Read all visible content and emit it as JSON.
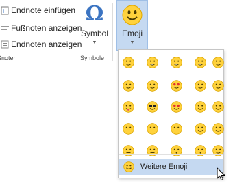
{
  "ribbon": {
    "footnotes": {
      "items": [
        {
          "label": "Endnote einfügen",
          "icon": "insert-endnote-icon"
        },
        {
          "label": "Fußnoten anzeigen",
          "icon": "show-footnotes-icon"
        },
        {
          "label": "Endnoten anzeigen",
          "icon": "show-endnotes-icon"
        }
      ],
      "group_label": "Fußnoten"
    },
    "symbols": {
      "symbol_label": "Symbol",
      "symbol_glyph": "Ω",
      "group_label": "Symbole",
      "emoji_label": "Emoji"
    }
  },
  "emoji_menu": {
    "emojis": [
      [
        "confounded-face",
        "grinning-face",
        "crying-laughing-face",
        "rofl-face",
        "slightly-smiling-face"
      ],
      [
        "smiling-face",
        "sweat-smile-face",
        "heart-eyes-face",
        "upside-down-face",
        "smiling-face-alt"
      ],
      [
        "tongue-out-face",
        "sunglasses-face",
        "heart-eyes-face-alt",
        "kissing-face",
        "squinting-face"
      ],
      [
        "neutral-face",
        "expressionless-face",
        "neutral-face-alt",
        "hugging-face",
        "thinking-face"
      ],
      [
        "grimacing-face",
        "unamused-face",
        "no-mouth-face",
        "confused-face",
        "winking-face"
      ]
    ],
    "more_label": "Weitere Emoji"
  },
  "colors": {
    "accent": "#c5d9f1",
    "accent_border": "#9fbfe6",
    "omega": "#3b74c2",
    "emoji_yellow": "#ffd23c"
  }
}
